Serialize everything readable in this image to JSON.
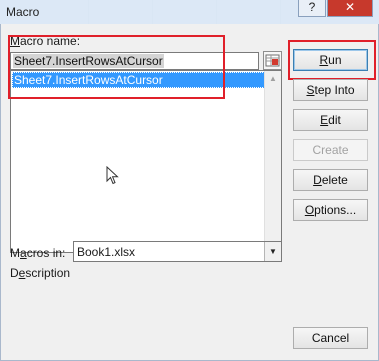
{
  "window": {
    "title": "Macro",
    "help_glyph": "?",
    "close_glyph": "✕"
  },
  "form": {
    "macro_name_label_pre": "",
    "macro_name_label_mnemonic": "M",
    "macro_name_label_post": "acro name:",
    "macro_name_value": "Sheet7.InsertRowsAtCursor",
    "macro_list": [
      "Sheet7.InsertRowsAtCursor"
    ],
    "macros_in_label_pre": "M",
    "macros_in_label_mnemonic": "a",
    "macros_in_label_post": "cros in:",
    "macros_in_value": "Book1.xlsx",
    "description_label_pre": "D",
    "description_label_mnemonic": "e",
    "description_label_post": "scription"
  },
  "buttons": {
    "run": {
      "mnemonic": "R",
      "rest": "un"
    },
    "step_into": {
      "mnemonic": "S",
      "rest": "tep Into"
    },
    "edit": {
      "mnemonic": "E",
      "rest": "dit"
    },
    "create": {
      "pre": "Create"
    },
    "delete": {
      "mnemonic": "D",
      "rest": "elete"
    },
    "options": {
      "mnemonic": "O",
      "rest": "ptions..."
    },
    "cancel": {
      "pre": "Cancel"
    }
  },
  "colors": {
    "highlight_box": "#e0202a",
    "selection": "#3399ff"
  },
  "icons": {
    "picker": "cell-reference-picker-icon",
    "dropdown": "chevron-down-icon",
    "cursor": "mouse-pointer-icon"
  }
}
